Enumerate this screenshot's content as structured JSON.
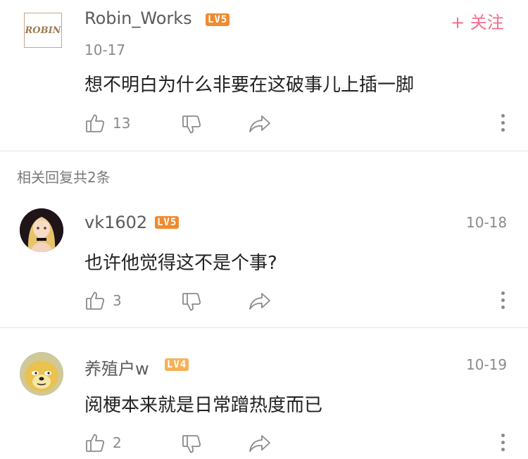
{
  "top_comment": {
    "author": "Robin_Works",
    "avatar_text": "ROBIN",
    "level": "LV5",
    "level_color": "#f08a2e",
    "date": "10-17",
    "follow_label": "+ 关注",
    "text": "想不明白为什么非要在这破事儿上插一脚",
    "like_count": "13"
  },
  "replies_header": "相关回复共2条",
  "replies": [
    {
      "author": "vk1602",
      "level": "LV5",
      "level_color": "#f08a2e",
      "date": "10-18",
      "text": "也许他觉得这不是个事?",
      "like_count": "3"
    },
    {
      "author": "养殖户w",
      "level": "LV4",
      "level_color": "#f5b15a",
      "date": "10-19",
      "text": "阅梗本来就是日常蹭热度而已",
      "like_count": "2"
    }
  ],
  "icons": [
    "like-icon",
    "dislike-icon",
    "share-icon",
    "more-icon"
  ]
}
